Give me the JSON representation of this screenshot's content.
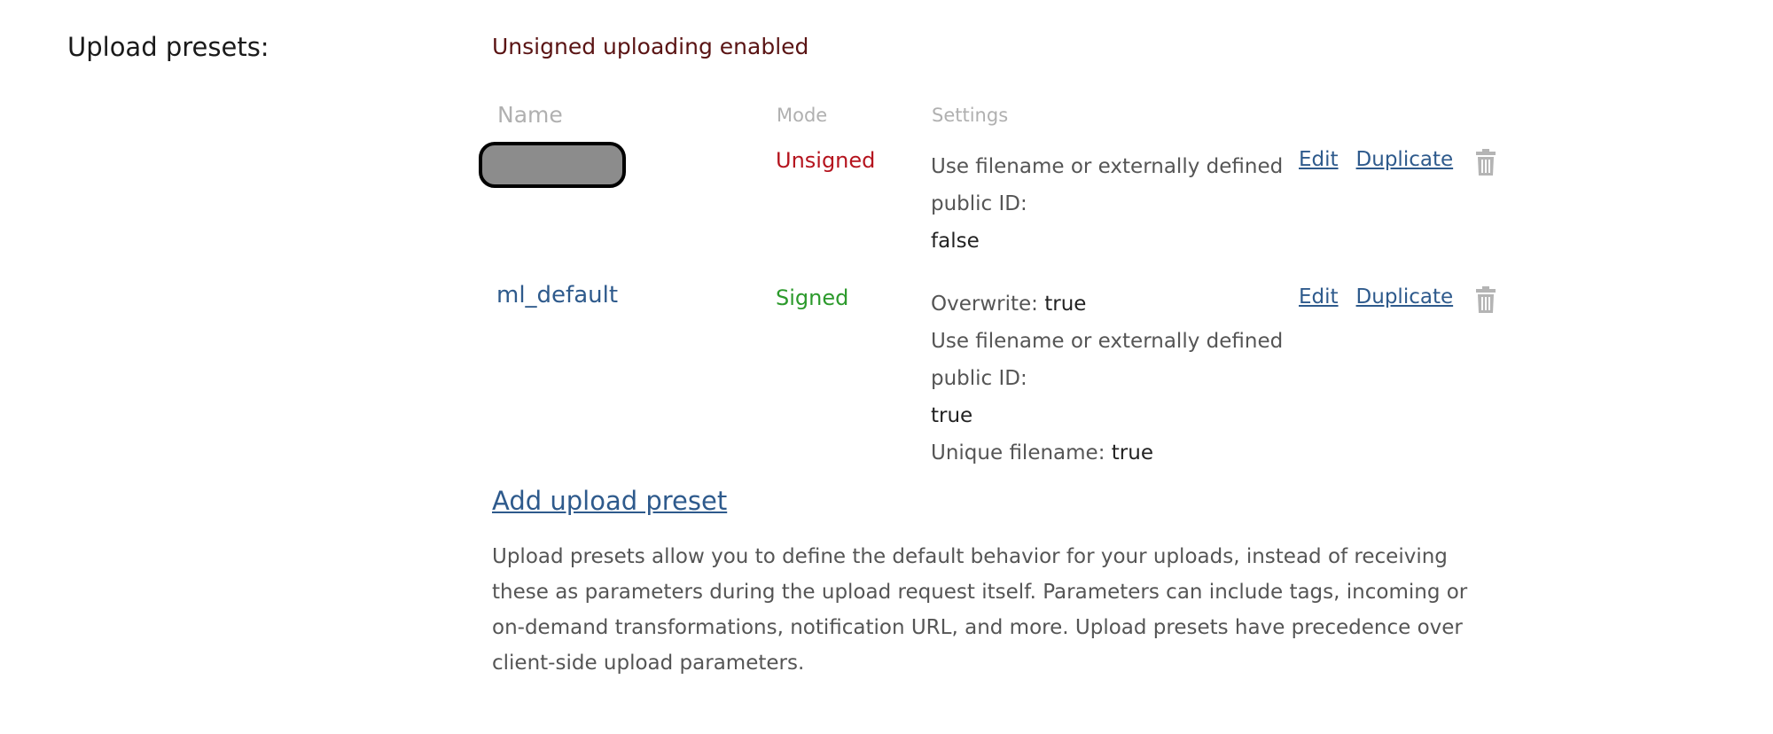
{
  "section": {
    "label": "Upload presets:",
    "status": "Unsigned uploading enabled"
  },
  "table": {
    "headers": {
      "name": "Name",
      "mode": "Mode",
      "settings": "Settings"
    },
    "rows": [
      {
        "name": "",
        "name_redacted": true,
        "mode": "Unsigned",
        "settings": [
          {
            "label": "Use filename or externally defined public ID:",
            "value": "false"
          }
        ],
        "edit_label": "Edit",
        "duplicate_label": "Duplicate",
        "delete_icon": "trash-icon"
      },
      {
        "name": "ml_default",
        "name_redacted": false,
        "mode": "Signed",
        "settings": [
          {
            "label": "Overwrite:",
            "value": "true"
          },
          {
            "label": "Use filename or externally defined public ID:",
            "value": "true"
          },
          {
            "label": "Unique filename:",
            "value": "true"
          }
        ],
        "edit_label": "Edit",
        "duplicate_label": "Duplicate",
        "delete_icon": "trash-icon"
      }
    ]
  },
  "add_preset_label": "Add upload preset",
  "description": "Upload presets allow you to define the default behavior for your uploads, instead of receiving these as parameters during the upload request itself. Parameters can include tags, incoming or on-demand transformations, notification URL, and more. Upload presets have precedence over client-side upload parameters.",
  "colors": {
    "link": "#2e5a8c",
    "unsigned": "#b5141e",
    "signed": "#2c9a2c",
    "status": "#5a1414",
    "header": "#b0b0b0"
  }
}
